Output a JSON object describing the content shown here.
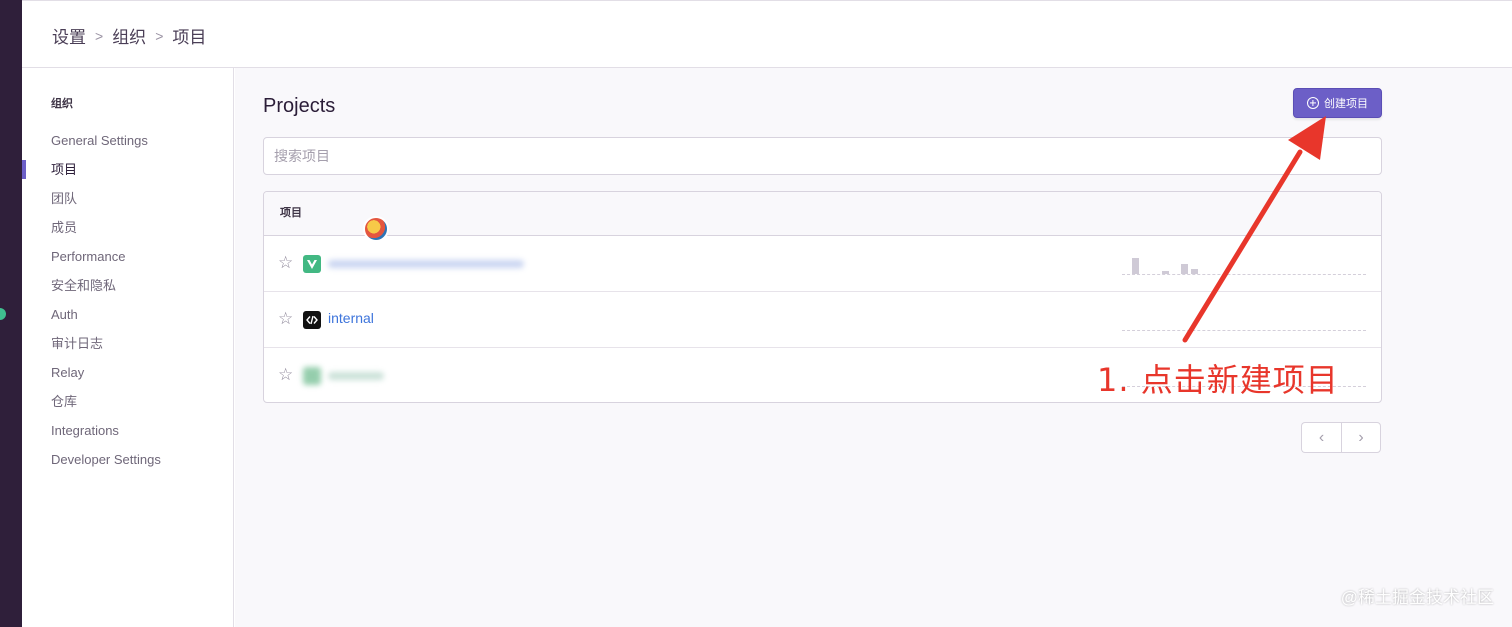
{
  "breadcrumb": {
    "items": [
      "设置",
      "组织",
      "项目"
    ]
  },
  "sidebar": {
    "group_title": "组织",
    "items": [
      {
        "label": "General Settings"
      },
      {
        "label": "项目",
        "active": true
      },
      {
        "label": "团队"
      },
      {
        "label": "成员"
      },
      {
        "label": "Performance"
      },
      {
        "label": "安全和隐私"
      },
      {
        "label": "Auth"
      },
      {
        "label": "审计日志"
      },
      {
        "label": "Relay"
      },
      {
        "label": "仓库"
      },
      {
        "label": "Integrations"
      },
      {
        "label": "Developer Settings"
      }
    ]
  },
  "main": {
    "title": "Projects",
    "create_button": {
      "label": "创建项目",
      "icon": "plus-circle-icon"
    },
    "search": {
      "placeholder": "搜索项目",
      "value": ""
    },
    "table": {
      "header": "项目",
      "rows": [
        {
          "name": "",
          "icon": "vue-icon",
          "icon_color": "#42b883",
          "blurred": true,
          "starred": false
        },
        {
          "name": "internal",
          "icon": "code-icon",
          "icon_color": "#111111",
          "blurred": false,
          "starred": false
        },
        {
          "name": "",
          "icon": "app-icon",
          "icon_color": "#3fa66a",
          "blurred": true,
          "starred": false
        }
      ]
    },
    "pagination": {
      "prev_icon": "chevron-left-icon",
      "next_icon": "chevron-right-icon"
    }
  },
  "annotation": {
    "text": "1. 点击新建项目",
    "color": "#e8362b"
  },
  "watermark": "@稀土掘金技术社区",
  "colors": {
    "accent": "#6c5fc7",
    "link": "#3d74db",
    "sidebar_dark": "#2f1f3a"
  }
}
